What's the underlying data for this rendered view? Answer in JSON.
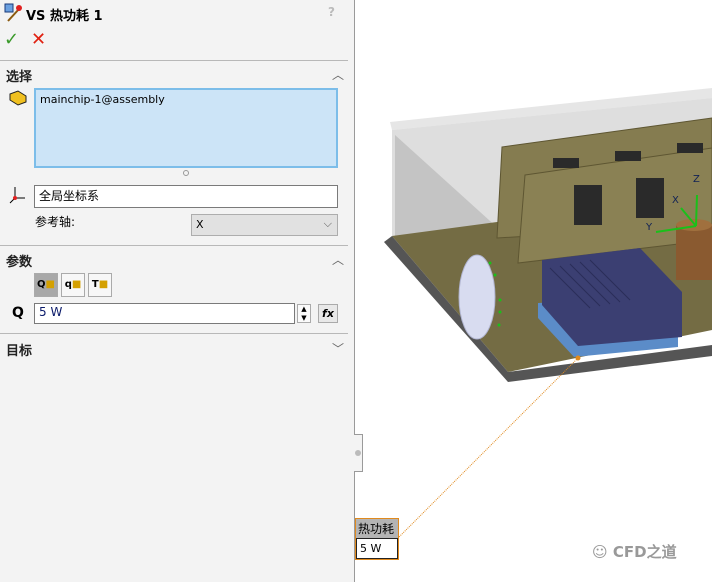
{
  "header": {
    "title": "VS 热功耗 1",
    "help_icon": "question-icon",
    "ok_icon": "checkmark-icon",
    "cancel_icon": "close-icon"
  },
  "selection": {
    "title": "选择",
    "item": "mainchip-1@assembly",
    "coordinate_system": "全局坐标系",
    "ref_axis_label": "参考轴:",
    "ref_axis_value": "X"
  },
  "parameters": {
    "title": "参数",
    "mode_buttons": [
      {
        "label": "Q",
        "selected": true
      },
      {
        "label": "q",
        "selected": false
      },
      {
        "label": "T",
        "selected": false
      }
    ],
    "q_label": "Q",
    "q_value": "5 W",
    "fx_label": "fx"
  },
  "goals": {
    "title": "目标"
  },
  "viewport": {
    "callout_title": "热功耗",
    "callout_value": "5 W",
    "axis_labels": [
      "X",
      "Y",
      "Z"
    ],
    "accent": "#e08a1e"
  },
  "watermark": "CFD之道"
}
